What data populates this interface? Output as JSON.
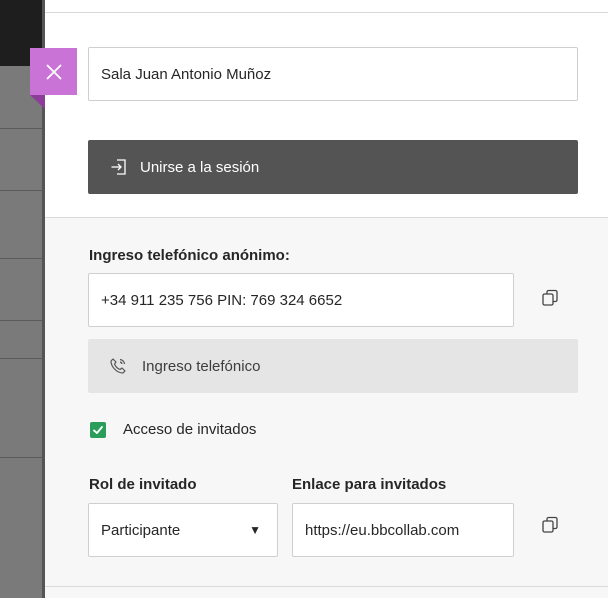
{
  "session": {
    "room_name": "Sala Juan Antonio Muñoz",
    "join_label": "Unirse a la sesión"
  },
  "phone": {
    "heading": "Ingreso telefónico anónimo:",
    "number": "+34 911 235 756 PIN: 769 324 6652",
    "button_label": "Ingreso telefónico"
  },
  "guest": {
    "access_label": "Acceso de invitados",
    "access_checked": true,
    "role_heading": "Rol de invitado",
    "role_value": "Participante",
    "link_heading": "Enlace para invitados",
    "link_value": "https://eu.bbcollab.com"
  },
  "colors": {
    "close_accent": "#c973d6",
    "join_button": "#545454",
    "checkbox": "#2a9d5a"
  },
  "icons": {
    "close": "close-icon",
    "join": "sign-in-icon",
    "copy": "copy-icon",
    "phone": "phone-icon",
    "caret": "caret-down-icon"
  }
}
